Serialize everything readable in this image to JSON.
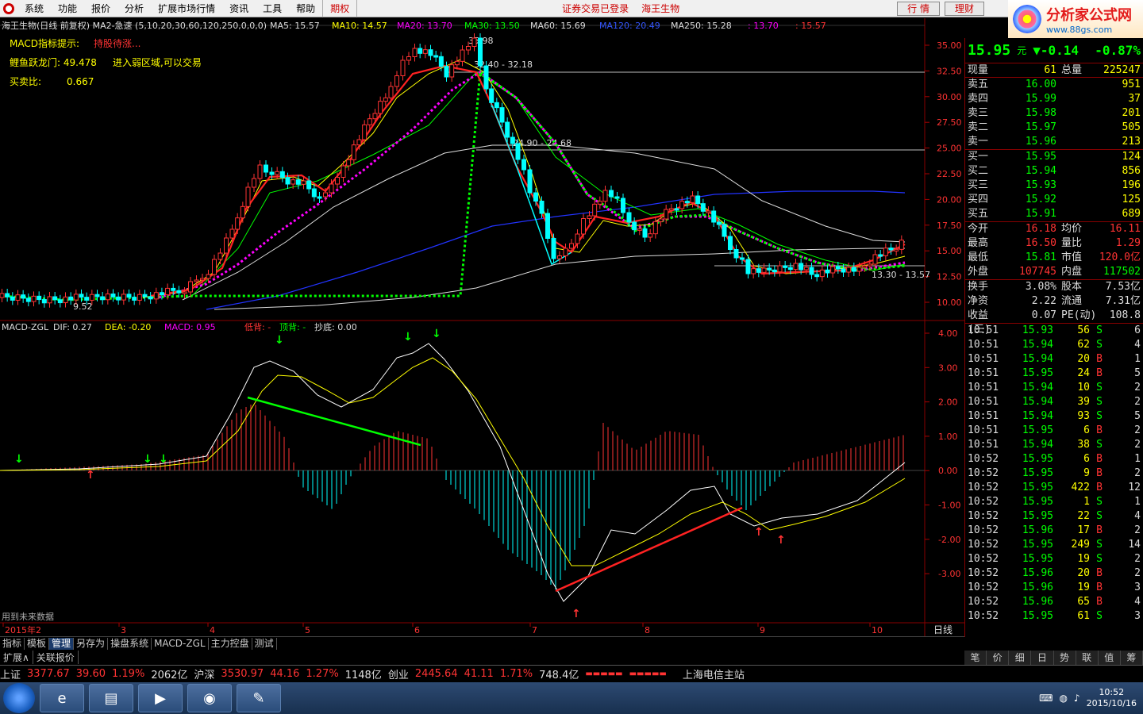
{
  "menubar": {
    "items": [
      "系统",
      "功能",
      "报价",
      "分析",
      "扩展市场行情",
      "资讯",
      "工具",
      "帮助"
    ],
    "futures": "期权",
    "status": "证券交易已登录",
    "stock": "海王生物",
    "btn_quote": "行 情",
    "btn_finance": "理财"
  },
  "brand": {
    "name": "分析家公式网",
    "url": "www.88gs.com"
  },
  "main_header": {
    "title": "海王生物(日线 前复权) MA2-急速 (5,10,20,30,60,120,250,0,0,0)",
    "ma5": "MA5: 15.57",
    "ma10": "MA10: 14.57",
    "ma20": "MA20: 13.70",
    "ma30": "MA30: 13.50",
    "ma60": "MA60: 15.69",
    "ma120": "MA120: 20.49",
    "ma250": "MA250: 15.28",
    "extra1": ": 13.70",
    "extra2": ": 15.57"
  },
  "indicators": {
    "macd_label": "MACD指标提示:",
    "macd_value": "持股待涨...",
    "liyu_label": "鲤鱼跃龙门: 49.478",
    "liyu_value": "进入弱区域,可以交易",
    "ratio_label": "买卖比:",
    "ratio_value": "0.667"
  },
  "annotations": {
    "high": "35.98",
    "low": "9.52",
    "band1": "32.40 - 32.18",
    "band2": "24.90 - 24.68",
    "band3": "13.30 - 13.57"
  },
  "price_axis": [
    "35.00",
    "32.50",
    "30.00",
    "27.50",
    "25.00",
    "22.50",
    "20.00",
    "17.50",
    "15.00",
    "12.50",
    "10.00"
  ],
  "macd_header": {
    "name": "MACD-ZGL",
    "dif": "DIF: 0.27",
    "dea": "DEA: -0.20",
    "macd": "MACD: 0.95",
    "low_div": "低背: -",
    "top_div": "顶背: -",
    "bottom": "抄底: 0.00"
  },
  "macd_axis": [
    "4.00",
    "3.00",
    "2.00",
    "1.00",
    "0.00",
    "-1.00",
    "-2.00",
    "-3.00"
  ],
  "future_data_note": "用到未来数据",
  "date_axis": [
    "2015年2",
    "3",
    "4",
    "5",
    "6",
    "7",
    "8",
    "9",
    "10"
  ],
  "period_label": "日线",
  "bottom_tabs": [
    "指标",
    "模板",
    "管理",
    "另存为",
    "操盘系统",
    "MACD-ZGL",
    "主力控盘",
    "测试"
  ],
  "bottom_tabs2": [
    "扩展∧",
    "关联报价"
  ],
  "quote": {
    "price": "15.95",
    "unit": "元",
    "change": "▼-0.14",
    "pct": "-0.87%",
    "xianliang_label": "现量",
    "xianliang": "61",
    "zongliang_label": "总量",
    "zongliang": "225247",
    "sell": [
      {
        "label": "卖五",
        "price": "16.00",
        "vol": "951"
      },
      {
        "label": "卖四",
        "price": "15.99",
        "vol": "37"
      },
      {
        "label": "卖三",
        "price": "15.98",
        "vol": "201"
      },
      {
        "label": "卖二",
        "price": "15.97",
        "vol": "505"
      },
      {
        "label": "卖一",
        "price": "15.96",
        "vol": "213"
      }
    ],
    "buy": [
      {
        "label": "买一",
        "price": "15.95",
        "vol": "124"
      },
      {
        "label": "买二",
        "price": "15.94",
        "vol": "856"
      },
      {
        "label": "买三",
        "price": "15.93",
        "vol": "196"
      },
      {
        "label": "买四",
        "price": "15.92",
        "vol": "125"
      },
      {
        "label": "买五",
        "price": "15.91",
        "vol": "689"
      }
    ],
    "stats": [
      {
        "l1": "今开",
        "v1": "16.18",
        "l2": "均价",
        "v2": "16.11"
      },
      {
        "l1": "最高",
        "v1": "16.50",
        "l2": "量比",
        "v2": "1.29"
      },
      {
        "l1": "最低",
        "v1": "15.81",
        "l2": "市值",
        "v2": "120.0亿"
      },
      {
        "l1": "外盘",
        "v1": "107745",
        "l2": "内盘",
        "v2": "117502"
      }
    ],
    "stats2": [
      {
        "l1": "换手",
        "v1": "3.08%",
        "l2": "股本",
        "v2": "7.53亿"
      },
      {
        "l1": "净资",
        "v1": "2.22",
        "l2": "流通",
        "v2": "7.31亿"
      },
      {
        "l1": "收益(三)",
        "v1": "0.07",
        "l2": "PE(动)",
        "v2": "108.8"
      }
    ],
    "ticks": [
      {
        "t": "10:51",
        "p": "15.93",
        "v": "56",
        "bs": "S",
        "n": "6"
      },
      {
        "t": "10:51",
        "p": "15.94",
        "v": "62",
        "bs": "S",
        "n": "4"
      },
      {
        "t": "10:51",
        "p": "15.94",
        "v": "20",
        "bs": "B",
        "n": "1"
      },
      {
        "t": "10:51",
        "p": "15.95",
        "v": "24",
        "bs": "B",
        "n": "5"
      },
      {
        "t": "10:51",
        "p": "15.94",
        "v": "10",
        "bs": "S",
        "n": "2"
      },
      {
        "t": "10:51",
        "p": "15.94",
        "v": "39",
        "bs": "S",
        "n": "2"
      },
      {
        "t": "10:51",
        "p": "15.94",
        "v": "93",
        "bs": "S",
        "n": "5"
      },
      {
        "t": "10:51",
        "p": "15.95",
        "v": "6",
        "bs": "B",
        "n": "2"
      },
      {
        "t": "10:51",
        "p": "15.94",
        "v": "38",
        "bs": "S",
        "n": "2"
      },
      {
        "t": "10:52",
        "p": "15.95",
        "v": "6",
        "bs": "B",
        "n": "1"
      },
      {
        "t": "10:52",
        "p": "15.95",
        "v": "9",
        "bs": "B",
        "n": "2"
      },
      {
        "t": "10:52",
        "p": "15.95",
        "v": "422",
        "bs": "B",
        "n": "12"
      },
      {
        "t": "10:52",
        "p": "15.95",
        "v": "1",
        "bs": "S",
        "n": "1"
      },
      {
        "t": "10:52",
        "p": "15.95",
        "v": "22",
        "bs": "S",
        "n": "4"
      },
      {
        "t": "10:52",
        "p": "15.96",
        "v": "17",
        "bs": "B",
        "n": "2"
      },
      {
        "t": "10:52",
        "p": "15.95",
        "v": "249",
        "bs": "S",
        "n": "14"
      },
      {
        "t": "10:52",
        "p": "15.95",
        "v": "19",
        "bs": "S",
        "n": "2"
      },
      {
        "t": "10:52",
        "p": "15.96",
        "v": "20",
        "bs": "B",
        "n": "2"
      },
      {
        "t": "10:52",
        "p": "15.96",
        "v": "19",
        "bs": "B",
        "n": "3"
      },
      {
        "t": "10:52",
        "p": "15.96",
        "v": "65",
        "bs": "B",
        "n": "4"
      },
      {
        "t": "10:52",
        "p": "15.95",
        "v": "61",
        "bs": "S",
        "n": "3"
      }
    ]
  },
  "right_tabs": [
    "笔",
    "价",
    "细",
    "日",
    "势",
    "联",
    "值",
    "筹"
  ],
  "ticker": {
    "sh_label": "上证",
    "sh_price": "3377.67",
    "sh_chg": "39.60",
    "sh_pct": "1.19%",
    "sh_amt": "2062亿",
    "hs_label": "沪深",
    "hs_price": "3530.97",
    "hs_chg": "44.16",
    "hs_pct": "1.27%",
    "hs_amt": "1148亿",
    "cy_label": "创业",
    "cy_price": "2445.64",
    "cy_chg": "41.11",
    "cy_pct": "1.71%",
    "cy_amt": "748.4亿",
    "station": "上海电信主站"
  },
  "taskbar": {
    "time": "10:52",
    "date": "2015/10/16"
  },
  "colors": {
    "up": "#ff3333",
    "down": "#00ffff",
    "green": "#00ff00",
    "yellow": "#ffff00",
    "magenta": "#ff00ff",
    "grid": "#800000"
  }
}
